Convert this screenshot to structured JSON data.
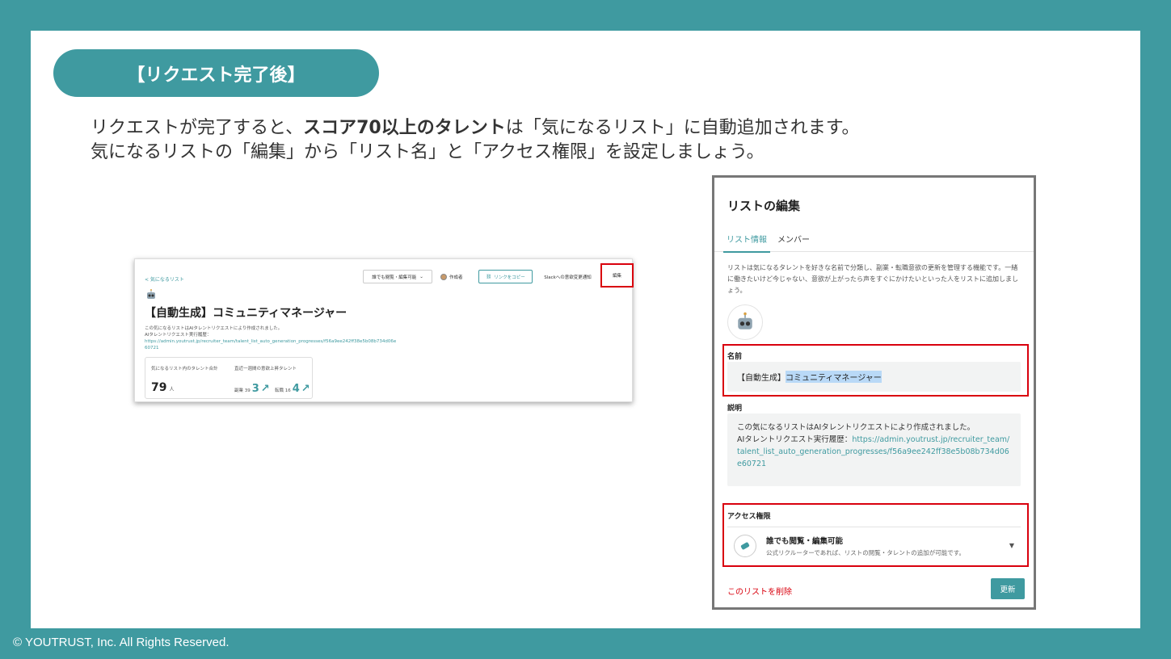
{
  "header": {
    "pill_label": "【リクエスト完了後】",
    "line1_pre": "リクエストが完了すると、",
    "line1_bold": "スコア70以上のタレント",
    "line1_post": "は「気になるリスト」に自動追加されます。",
    "line2": "気になるリストの「編集」から「リスト名」と「アクセス権限」を設定しましょう。"
  },
  "footer": {
    "copyright": "© YOUTRUST, Inc. All Rights Reserved."
  },
  "list_page": {
    "back_link": "< 気になるリスト",
    "permission_select": "誰でも閲覧・編集可能",
    "author_label": "作成者",
    "copy_link_button": "リンクをコピー",
    "slack_button": "Slackへの意欲変更通知",
    "edit_button": "編集",
    "title": "【自動生成】コミュニティマネージャー",
    "desc_line1": "この気になるリストはAIタレントリクエストにより作成されました。",
    "desc_line2": "AIタレントリクエスト実行履歴：",
    "desc_link1": "https://admin.youtrust.jp/recruiter_team/talent_list_auto_generation_progresses/f56a9ee242ff38e5b08b734d06e",
    "desc_link2": "60721",
    "stat_total_label": "気になるリスト内のタレント合計",
    "stat_recent_label": "直近一週間の意欲上昇タレント",
    "stat_total_value": "79",
    "stat_total_unit": "人",
    "stat_side_job_label": "副業 39",
    "stat_side_job_value": "3",
    "stat_job_change_label": "転職 16",
    "stat_job_change_value": "4"
  },
  "edit_dialog": {
    "title": "リストの編集",
    "tab_info": "リスト情報",
    "tab_members": "メンバー",
    "explanation": "リストは気になるタレントを好きな名前で分類し、副業・転職意欲の更新を管理する機能です。一緒に働きたいけど今じゃない、意欲が上がったら声をすぐにかけたいといった人をリストに追加しましょう。",
    "name_label": "名前",
    "name_prefix": "【自動生成】",
    "name_selected": "コミュニティマネージャー",
    "desc_label": "説明",
    "desc_line1": "この気になるリストはAIタレントリクエストにより作成されました。",
    "desc_line2_prefix": "AIタレントリクエスト実行履歴：",
    "desc_link": "https://admin.youtrust.jp/recruiter_team/talent_list_auto_generation_progresses/f56a9ee242ff38e5b08b734d06e60721",
    "access_label": "アクセス権限",
    "access_option_title": "誰でも閲覧・編集可能",
    "access_option_desc": "公式リクルーターであれば、リストの閲覧・タレントの追加が可能です。",
    "delete_link": "このリストを削除",
    "update_button": "更新"
  },
  "colors": {
    "brand": "#3f9aa0",
    "highlight": "#d9000d"
  }
}
